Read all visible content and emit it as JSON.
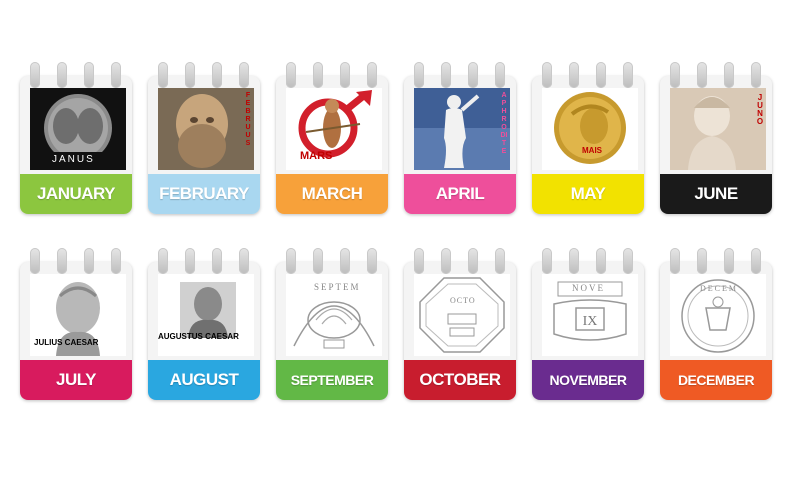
{
  "months": [
    {
      "name": "JANUARY",
      "color": "#8cc63f",
      "caption": "JANUS"
    },
    {
      "name": "FEBRUARY",
      "color": "#a9d7f0",
      "caption": "FEBRUUS"
    },
    {
      "name": "MARCH",
      "color": "#f7a13a",
      "caption": "MARS"
    },
    {
      "name": "APRIL",
      "color": "#ee4f9b",
      "caption": "APHRODITE"
    },
    {
      "name": "MAY",
      "color": "#f2e200",
      "caption": "MAIS"
    },
    {
      "name": "JUNE",
      "color": "#1a1a1a",
      "caption": "JUNO"
    },
    {
      "name": "JULY",
      "color": "#d81b5e",
      "caption": "JULIUS CAESAR"
    },
    {
      "name": "AUGUST",
      "color": "#2aa7e0",
      "caption": "AUGUSTUS CAESAR"
    },
    {
      "name": "SEPTEMBER",
      "color": "#62b846",
      "caption": "SEPTEM"
    },
    {
      "name": "OCTOBER",
      "color": "#c81d2e",
      "caption": "OCTO"
    },
    {
      "name": "NOVEMBER",
      "color": "#6a2c8f",
      "caption": "NOVE"
    },
    {
      "name": "DECEMBER",
      "color": "#ef5a24",
      "caption": "DECEM"
    }
  ]
}
